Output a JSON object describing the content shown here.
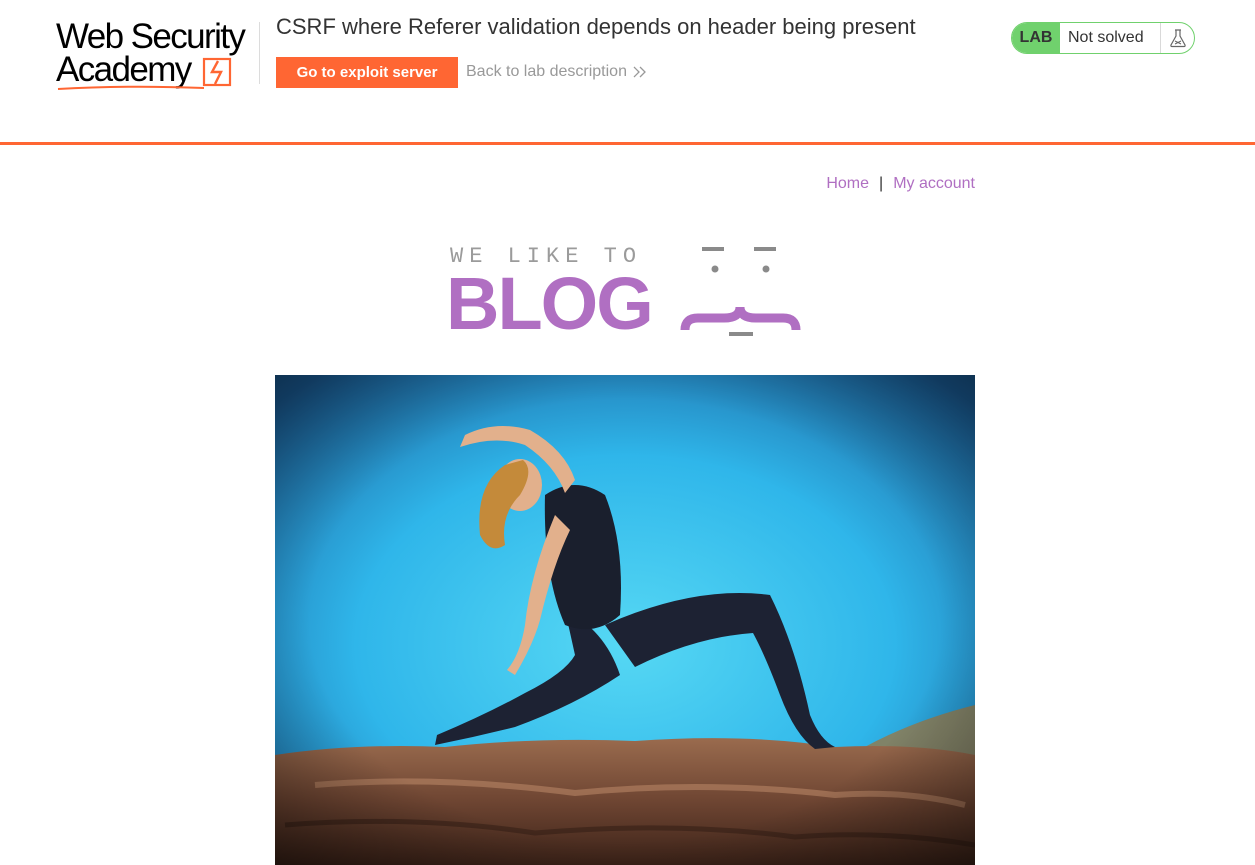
{
  "academy": {
    "logo_line1": "Web Security",
    "logo_line2": "Academy",
    "lab_title": "CSRF where Referer validation depends on header being present",
    "exploit_button": "Go to exploit server",
    "back_link": "Back to lab description",
    "status_tag": "LAB",
    "status_text": "Not solved",
    "accent_color": "#ff6633",
    "status_color": "#70d16d"
  },
  "nav": {
    "home": "Home",
    "separator": "|",
    "my_account": "My account",
    "link_color": "#b06fc2"
  },
  "blog_logo": {
    "tagline": "WE LIKE TO",
    "word": "BLOG"
  },
  "hero_image": {
    "subject": "yoga-pose-on-rock"
  }
}
